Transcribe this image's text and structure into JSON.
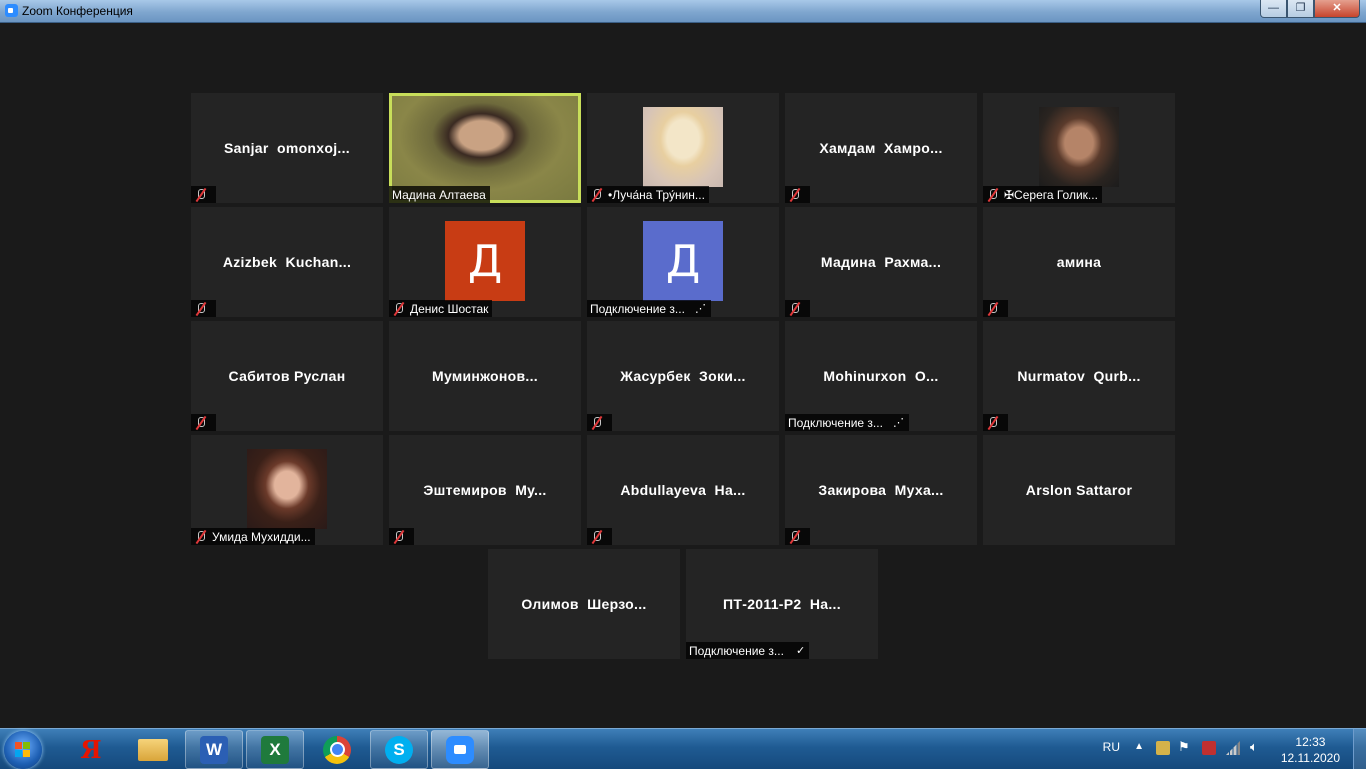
{
  "window": {
    "title": "Zoom Конференция"
  },
  "tiles": [
    {
      "name": "Sanjar  omonxoj...",
      "muted": true,
      "kind": "name"
    },
    {
      "name": "Мадина Алтаева",
      "kind": "video",
      "active": true
    },
    {
      "name": "•Луча́на Тру́нин...",
      "muted": true,
      "kind": "photo"
    },
    {
      "name": "Хамдам  Хамро...",
      "muted": true,
      "kind": "name"
    },
    {
      "name": "✠Серега Голик...",
      "muted": true,
      "kind": "photo"
    },
    {
      "name": "Azizbek  Kuchan...",
      "muted": true,
      "kind": "name"
    },
    {
      "name": "Денис Шостак",
      "muted": true,
      "kind": "avatar",
      "initial": "Д",
      "color": "#c83c14"
    },
    {
      "name": "Подключение з...",
      "kind": "avatar",
      "initial": "Д",
      "color": "#5a6ccc",
      "status": "⋰"
    },
    {
      "name": "Мадина  Рахма...",
      "muted": true,
      "kind": "name"
    },
    {
      "name": "амина",
      "muted": true,
      "kind": "name"
    },
    {
      "name": "Сабитов Руслан",
      "muted": true,
      "kind": "name"
    },
    {
      "name": "Муминжонов...",
      "kind": "name"
    },
    {
      "name": "Жасурбек  Зоки...",
      "muted": true,
      "kind": "name"
    },
    {
      "name": "Mohinurxon  O...",
      "kind": "name",
      "label": "Подключение з...",
      "status": "⋰"
    },
    {
      "name": "Nurmatov  Qurb...",
      "muted": true,
      "kind": "name"
    },
    {
      "name": "Умида Мухидди...",
      "muted": true,
      "kind": "photo"
    },
    {
      "name": "Эштемиров  Му...",
      "muted": true,
      "kind": "name"
    },
    {
      "name": "Abdullayeva  Ha...",
      "muted": true,
      "kind": "name"
    },
    {
      "name": "Закирова  Муха...",
      "muted": true,
      "kind": "name"
    },
    {
      "name": "Arslon Sattaror",
      "kind": "name"
    },
    {
      "name": "Олимов  Шерзо...",
      "kind": "name"
    },
    {
      "name": "ПТ-2011-Р2  На...",
      "kind": "name",
      "label": "Подключение з...",
      "status": "✓"
    }
  ],
  "taskbar": {
    "apps": [
      "Start",
      "Yandex",
      "Explorer",
      "Word",
      "Excel",
      "Chrome",
      "Skype",
      "Zoom"
    ],
    "language": "RU",
    "time": "12:33",
    "date": "12.11.2020"
  }
}
